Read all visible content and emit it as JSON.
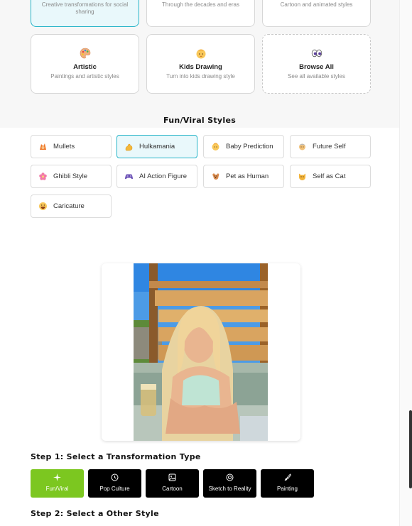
{
  "top_cards_partial": [
    {
      "desc": "Creative transformations for social sharing",
      "selected": true
    },
    {
      "desc": "Through the decades and eras",
      "selected": false
    },
    {
      "desc": "Cartoon and animated styles",
      "selected": false
    }
  ],
  "category_cards": [
    {
      "title": "Artistic",
      "desc": "Paintings and artistic styles",
      "icon": "palette-icon"
    },
    {
      "title": "Kids Drawing",
      "desc": "Turn into kids drawing style",
      "icon": "baby-icon"
    },
    {
      "title": "Browse All",
      "desc": "See all available styles",
      "icon": "eyes-icon"
    }
  ],
  "fun_viral": {
    "title": "Fun/Viral Styles",
    "styles": [
      {
        "label": "Mullets",
        "icon": "mullet-icon",
        "selected": false
      },
      {
        "label": "Hulkamania",
        "icon": "flexed-arm-icon",
        "selected": true
      },
      {
        "label": "Baby Prediction",
        "icon": "baby-face-icon",
        "selected": false
      },
      {
        "label": "Future Self",
        "icon": "future-self-icon",
        "selected": false
      },
      {
        "label": "Ghibli Style",
        "icon": "blossom-icon",
        "selected": false
      },
      {
        "label": "AI Action Figure",
        "icon": "gamepad-icon",
        "selected": false
      },
      {
        "label": "Pet as Human",
        "icon": "dog-icon",
        "selected": false
      },
      {
        "label": "Self as Cat",
        "icon": "cat-icon",
        "selected": false
      },
      {
        "label": "Caricature",
        "icon": "grin-icon",
        "selected": false
      }
    ]
  },
  "step1": {
    "title": "Step 1: Select a Transformation Type",
    "types": [
      {
        "label": "Fun/Viral",
        "icon": "sparkle-icon",
        "active": true
      },
      {
        "label": "Pop Culture",
        "icon": "clock-icon",
        "active": false
      },
      {
        "label": "Cartoon",
        "icon": "image-icon",
        "active": false
      },
      {
        "label": "Sketch to Reality",
        "icon": "target-icon",
        "active": false
      },
      {
        "label": "Painting",
        "icon": "brush-icon",
        "active": false
      }
    ]
  },
  "step2": {
    "title": "Step 2: Select a Other Style"
  },
  "colors": {
    "accent_green": "#7cc720",
    "accent_teal": "#26b4c8"
  }
}
